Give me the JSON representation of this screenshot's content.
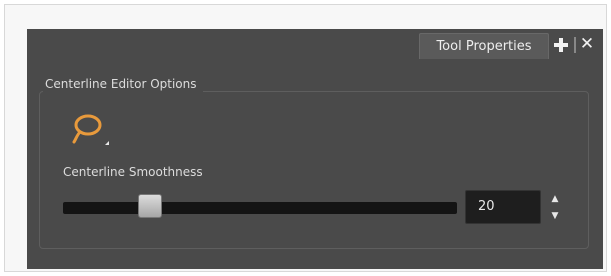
{
  "panel": {
    "tab_label": "Tool Properties",
    "add_icon": "plus-icon",
    "close_icon": "close-icon",
    "close_glyph": "✕"
  },
  "group": {
    "title": "Centerline Editor Options",
    "tool_icon": "lasso-icon"
  },
  "smoothness": {
    "label": "Centerline Smoothness",
    "value": "20",
    "slider_fraction": 0.22,
    "up_glyph": "▲",
    "down_glyph": "▼"
  },
  "colors": {
    "panel_bg": "#4a4a4a",
    "icon_accent": "#e89a3c",
    "track": "#141414"
  }
}
